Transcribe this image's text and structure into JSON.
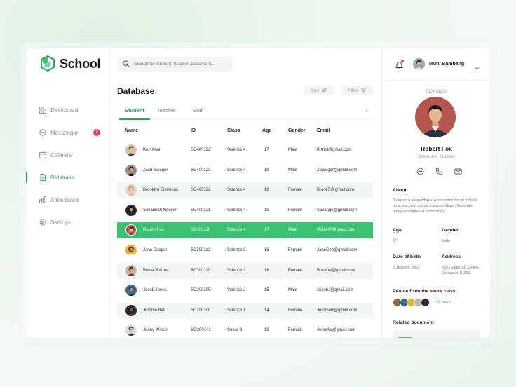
{
  "brand": {
    "name": "School",
    "accent": "#2fa35a"
  },
  "search": {
    "placeholder": "Search for student, teacher, document..."
  },
  "sidebar": {
    "items": [
      {
        "label": "Dashboard",
        "icon": "grid-icon"
      },
      {
        "label": "Messenger",
        "icon": "chat-icon",
        "badge": "3"
      },
      {
        "label": "Calendar",
        "icon": "calendar-icon"
      },
      {
        "label": "Database",
        "icon": "file-icon",
        "active": true
      },
      {
        "label": "Attendance",
        "icon": "bar-chart-icon"
      },
      {
        "label": "Settings",
        "icon": "gear-icon"
      }
    ]
  },
  "main": {
    "title": "Database",
    "sort_label": "Sort",
    "filter_label": "Filter",
    "tabs": [
      "Student",
      "Teacher",
      "Staff"
    ],
    "columns": [
      "Name",
      "ID",
      "Class",
      "Age",
      "Gender",
      "Email"
    ],
    "rows": [
      {
        "name": "Ken Khoi",
        "id": "SC400122",
        "class": "Science 4",
        "age": "17",
        "gender": "Male",
        "email": "KKhoi@gmail.com"
      },
      {
        "name": "Zach Sweger",
        "id": "SC400123",
        "class": "Science 4",
        "age": "18",
        "gender": "Male",
        "email": "ZSweger@gmail.com"
      },
      {
        "name": "Brooklyn Simmons",
        "id": "SC400122",
        "class": "Science 4",
        "age": "18",
        "gender": "Female",
        "email": "BrookS@gmail.com"
      },
      {
        "name": "Savannah Nguyen",
        "id": "SC400121",
        "class": "Science 4",
        "age": "19",
        "gender": "Female",
        "email": "Savangu@gmail.com"
      },
      {
        "name": "Robert Fox",
        "id": "SC400120",
        "class": "Science 4",
        "age": "17",
        "gender": "Male",
        "email": "RobertF@gmail.com"
      },
      {
        "name": "Jane Cooper",
        "id": "SC300112",
        "class": "Science 3",
        "age": "18",
        "gender": "Female",
        "email": "JaneCoo@gmail.com"
      },
      {
        "name": "Wade Warren",
        "id": "SC300111",
        "class": "Science 3",
        "age": "16",
        "gender": "Female",
        "email": "WadeW@gmail.com"
      },
      {
        "name": "Jacob Jones",
        "id": "SC200105",
        "class": "Science 2",
        "age": "15",
        "gender": "Male",
        "email": "JacobJ@gmail.com"
      },
      {
        "name": "Jerome Bell",
        "id": "SC100100",
        "class": "Science 1",
        "age": "14",
        "gender": "Female",
        "email": "JeromeB@gmail.com"
      },
      {
        "name": "Jenny Wilson",
        "id": "SO300141",
        "class": "Social 3",
        "age": "18",
        "gender": "Female",
        "email": "JennyW@gmail.com"
      }
    ]
  },
  "user": {
    "name": "Muh. Bambang"
  },
  "profile": {
    "student_id": "SC400120",
    "name": "Robert Fox",
    "class": "Science 4 Student",
    "about_label": "About",
    "about_text": "Science is everywhere. A student rides to school on a bus, and in that instance alone, there are many examples of technology.",
    "age_label": "Age",
    "age": "17",
    "gender_label": "Gender",
    "gender": "Male",
    "dob_label": "Date of birth",
    "dob": "2 January 2003",
    "address_label": "Address",
    "address": "6391 Elgin St. Celina, Delaware 10299",
    "classmates_label": "People from the same class",
    "classmates_more": "+12 more",
    "related_label": "Related document"
  }
}
